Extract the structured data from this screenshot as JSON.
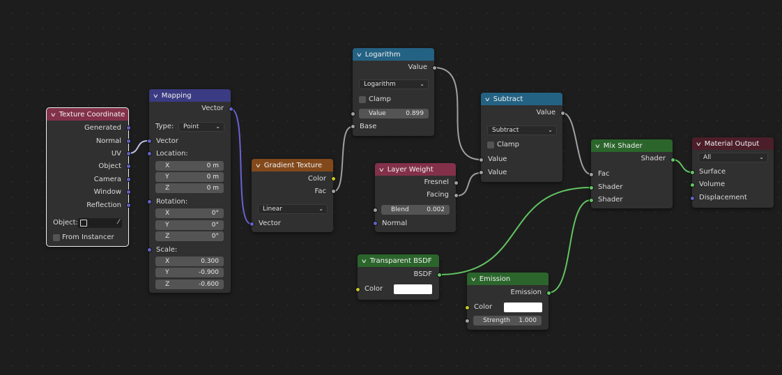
{
  "nodes": {
    "texcoord": {
      "title": "Texture Coordinate",
      "outputs": [
        "Generated",
        "Normal",
        "UV",
        "Object",
        "Camera",
        "Window",
        "Reflection"
      ],
      "object_label": "Object:",
      "from_instancer": "From Instancer"
    },
    "mapping": {
      "title": "Mapping",
      "output": "Vector",
      "type_label": "Type:",
      "type_value": "Point",
      "vector_label": "Vector",
      "location_label": "Location:",
      "location": [
        {
          "axis": "X",
          "value": "0 m"
        },
        {
          "axis": "Y",
          "value": "0 m"
        },
        {
          "axis": "Z",
          "value": "0 m"
        }
      ],
      "rotation_label": "Rotation:",
      "rotation": [
        {
          "axis": "X",
          "value": "0°"
        },
        {
          "axis": "Y",
          "value": "0°"
        },
        {
          "axis": "Z",
          "value": "0°"
        }
      ],
      "scale_label": "Scale:",
      "scale": [
        {
          "axis": "X",
          "value": "0.300"
        },
        {
          "axis": "Y",
          "value": "-0.900"
        },
        {
          "axis": "Z",
          "value": "-0.600"
        }
      ]
    },
    "gradient": {
      "title": "Gradient Texture",
      "outputs": [
        "Color",
        "Fac"
      ],
      "mode": "Linear",
      "input": "Vector"
    },
    "logarithm": {
      "title": "Logarithm",
      "output": "Value",
      "operation": "Logarithm",
      "clamp": "Clamp",
      "value_label": "Value",
      "value": "0.899",
      "input": "Base"
    },
    "layerweight": {
      "title": "Layer Weight",
      "outputs": [
        "Fresnel",
        "Facing"
      ],
      "blend_label": "Blend",
      "blend_value": "0.002",
      "input": "Normal"
    },
    "subtract": {
      "title": "Subtract",
      "output": "Value",
      "operation": "Subtract",
      "clamp": "Clamp",
      "inputs": [
        "Value",
        "Value"
      ]
    },
    "transparent": {
      "title": "Transparent BSDF",
      "output": "BSDF",
      "color_label": "Color"
    },
    "emission": {
      "title": "Emission",
      "output": "Emission",
      "color_label": "Color",
      "strength_label": "Strength",
      "strength_value": "1.000"
    },
    "mix": {
      "title": "Mix Shader",
      "output": "Shader",
      "inputs": [
        "Fac",
        "Shader",
        "Shader"
      ]
    },
    "output": {
      "title": "Material Output",
      "target": "All",
      "inputs": [
        "Surface",
        "Volume",
        "Displacement"
      ]
    }
  },
  "colors": {
    "canvas": "#1d1d1d",
    "node_body": "#303030",
    "input_header": "#83314a",
    "vector_header": "#3b3b83",
    "texture_header": "#83491b",
    "converter_header": "#246283",
    "shader_header": "#2b652b",
    "output_header": "#4c1e2a",
    "vector_socket": "#6363c7",
    "gray_socket": "#a1a1a1",
    "color_socket": "#c7c729",
    "shader_socket": "#63c763"
  },
  "icons": {
    "collapse": "chevron-down-icon",
    "object": "object-icon",
    "eyedropper": "eyedropper-icon"
  }
}
